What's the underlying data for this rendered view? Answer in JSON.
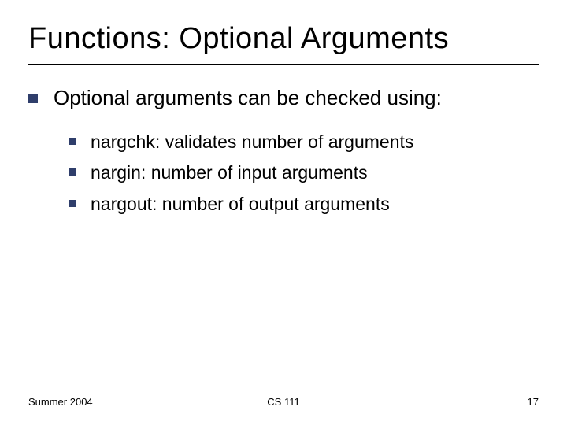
{
  "title": "Functions: Optional Arguments",
  "main_point": "Optional arguments can be checked using:",
  "subs": [
    "nargchk: validates number of arguments",
    "nargin: number of input arguments",
    "nargout: number of output arguments"
  ],
  "footer": {
    "left": "Summer 2004",
    "center": "CS 111",
    "right": "17"
  }
}
